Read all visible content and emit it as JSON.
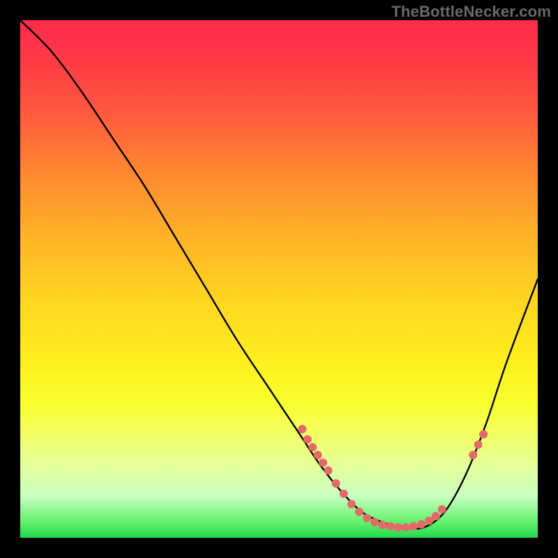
{
  "watermark": "TheBottleNecker.com",
  "chart_data": {
    "type": "line",
    "title": "",
    "xlabel": "",
    "ylabel": "",
    "xlim": [
      0,
      100
    ],
    "ylim": [
      0,
      100
    ],
    "grid": false,
    "note": "Axes have no tick labels; x/y are normalized 0–100 from pixel positions. y represents bottleneck % (lower is better, green at bottom).",
    "series": [
      {
        "name": "bottleneck-curve",
        "x": [
          0,
          6,
          12,
          18,
          24,
          30,
          36,
          42,
          48,
          54,
          58,
          62,
          66,
          70,
          74,
          78,
          82,
          86,
          90,
          94,
          100
        ],
        "y": [
          100,
          94,
          86,
          77,
          68,
          58,
          48,
          38,
          29,
          20,
          14,
          9,
          5,
          3,
          2,
          2,
          5,
          12,
          22,
          34,
          50
        ]
      }
    ],
    "markers": [
      {
        "x": 54.5,
        "y": 21
      },
      {
        "x": 55.5,
        "y": 19
      },
      {
        "x": 56.5,
        "y": 17.5
      },
      {
        "x": 57.5,
        "y": 16
      },
      {
        "x": 58.5,
        "y": 14.5
      },
      {
        "x": 59.5,
        "y": 13
      },
      {
        "x": 61.0,
        "y": 10.5
      },
      {
        "x": 62.5,
        "y": 8.5
      },
      {
        "x": 64.0,
        "y": 6.5
      },
      {
        "x": 65.5,
        "y": 5
      },
      {
        "x": 67.0,
        "y": 3.8
      },
      {
        "x": 68.5,
        "y": 3
      },
      {
        "x": 70.0,
        "y": 2.5
      },
      {
        "x": 71.5,
        "y": 2.2
      },
      {
        "x": 73.0,
        "y": 2
      },
      {
        "x": 74.5,
        "y": 2
      },
      {
        "x": 76.0,
        "y": 2.2
      },
      {
        "x": 77.5,
        "y": 2.6
      },
      {
        "x": 79.0,
        "y": 3.3
      },
      {
        "x": 80.3,
        "y": 4.2
      },
      {
        "x": 81.5,
        "y": 5.5
      },
      {
        "x": 87.5,
        "y": 16
      },
      {
        "x": 88.5,
        "y": 18
      },
      {
        "x": 89.5,
        "y": 20
      }
    ],
    "marker_color": "#e46a6a",
    "curve_color": "#000000"
  }
}
